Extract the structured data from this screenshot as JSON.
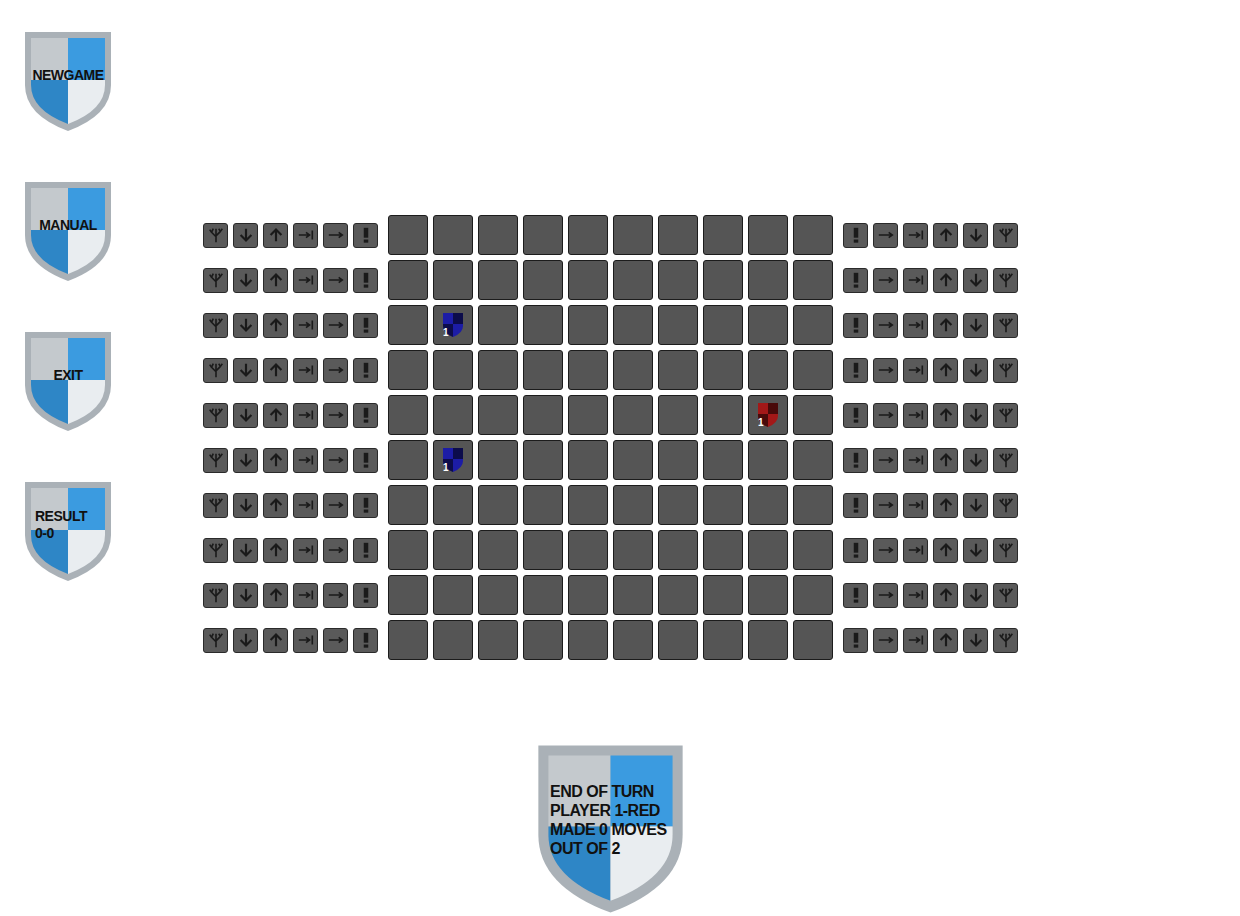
{
  "menu": [
    {
      "label": "NEWGAME"
    },
    {
      "label": "MANUAL"
    },
    {
      "label": "EXIT"
    }
  ],
  "result": {
    "label": "RESULT",
    "score": "0-0"
  },
  "board": {
    "rows": 10,
    "columns": 10,
    "units": [
      {
        "row": 2,
        "col": 1,
        "count": "1",
        "color": "#1c1ca6"
      },
      {
        "row": 5,
        "col": 1,
        "count": "1",
        "color": "#1c1ca6"
      },
      {
        "row": 4,
        "col": 8,
        "count": "1",
        "color": "#a31818"
      }
    ]
  },
  "end_turn": {
    "lines": [
      "END OF TURN",
      "PLAYER 1-RED",
      "MADE 0 MOVES",
      "OUT OF 2"
    ]
  }
}
